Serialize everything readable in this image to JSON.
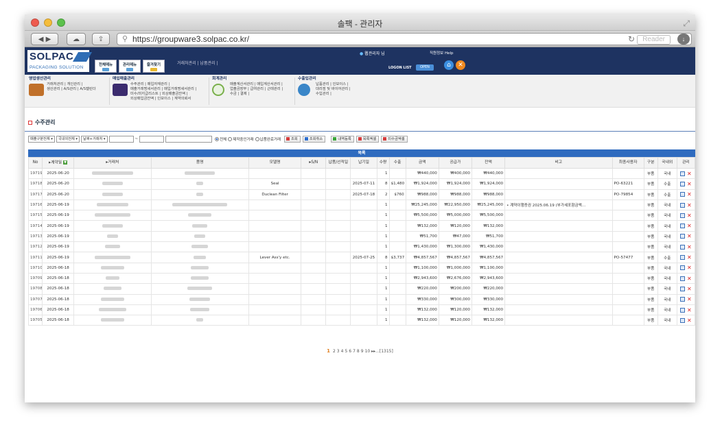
{
  "window": {
    "title": "솔팩 - 관리자"
  },
  "browser": {
    "url": "https://groupware3.solpac.co.kr/",
    "reader_label": "Reader"
  },
  "header": {
    "logo_main": "SOLPAC",
    "logo_sub": "PACKAGING SOLUTION",
    "tabs": [
      "전체메뉴",
      "관리메뉴",
      "즐겨찾기"
    ],
    "links": "거래처관리 | 납품관리 |",
    "user": "웹관리자 님",
    "top_links": "직원정보  Help",
    "logon_list": "LOGON LIST",
    "open_label": "OPEN"
  },
  "categories": [
    {
      "title": "영업생산관리",
      "lines": [
        "거래처관리 | 개인관리 |",
        "생산관리 | A/S관리 | A/S캘린더"
      ]
    },
    {
      "title": "매입매출관리",
      "lines": [
        "수주관리 | 매입자재관리 |",
        "매출거래명세서관리 | 매입거래명세서관리 |",
        "미수/미지급리스트 | 외상매출금잔액 |",
        "외상매입금잔액 | 인보이스 | 계약의뢰서"
      ]
    },
    {
      "title": "회계관리",
      "lines": [
        "매출계산서관리 | 매입계산서관리 |",
        "업출금장부 | 급여관리 | 근태관리 |",
        "수금 | 결제 |"
      ]
    },
    {
      "title": "수출입관리",
      "lines": [
        "납품관리 | 인보이스 |",
        "대리점 및 바이어관리 |",
        "수입관리 |"
      ]
    }
  ],
  "page": {
    "title": "수주관리",
    "list_label": "목록"
  },
  "filters": {
    "select1": "매출구분전체",
    "select2": "국내외전체",
    "select3": "날짜+거래처",
    "tilde": "~",
    "radios": [
      "전체",
      "제작중인거래",
      "납품완료거래"
    ],
    "buttons": [
      "조회",
      "조회취소",
      "내역등록",
      "목록엑셀",
      "미수금엑셀"
    ]
  },
  "columns": [
    "No",
    "▸계약일",
    "▸거래처",
    "품명",
    "모델명",
    "▸S/N",
    "납품/선적일",
    "납기일",
    "수량",
    "수출",
    "금액",
    "공급가",
    "잔액",
    "비고",
    "최종사용자",
    "구분",
    "국내외",
    "관리"
  ],
  "rows": [
    {
      "no": "19719",
      "date": "2025-06-20",
      "model": "",
      "due": "",
      "qty": "1",
      "export": "",
      "amount": "₩440,000",
      "supply": "₩400,000",
      "balance": "₩440,000",
      "note": "",
      "enduser": "",
      "type": "부품",
      "region": "국내"
    },
    {
      "no": "19718",
      "date": "2025-06-20",
      "model": "Seal",
      "due": "2025-07-11",
      "qty": "8",
      "export": "$1,480",
      "amount": "₩1,924,000",
      "supply": "₩1,924,000",
      "balance": "₩1,924,000",
      "note": "",
      "enduser": "PO-63221",
      "type": "부품",
      "region": "수출"
    },
    {
      "no": "19717",
      "date": "2025-06-20",
      "model": "Duclean Filter",
      "due": "2025-07-18",
      "qty": "2",
      "export": "$760",
      "amount": "₩988,000",
      "supply": "₩988,000",
      "balance": "₩988,000",
      "note": "",
      "enduser": "PO-79854",
      "type": "부품",
      "region": "수출"
    },
    {
      "no": "19716",
      "date": "2025-06-19",
      "model": "",
      "due": "",
      "qty": "1",
      "export": "",
      "amount": "₩25,245,000",
      "supply": "₩22,950,000",
      "balance": "₩25,245,000",
      "note": "• 계약이행증권 2025.06.19 (부가세포함금액...",
      "enduser": "",
      "type": "부품",
      "region": "국내"
    },
    {
      "no": "19715",
      "date": "2025-06-19",
      "model": "",
      "due": "",
      "qty": "1",
      "export": "",
      "amount": "₩5,500,000",
      "supply": "₩5,000,000",
      "balance": "₩5,500,000",
      "note": "",
      "enduser": "",
      "type": "부품",
      "region": "국내"
    },
    {
      "no": "19714",
      "date": "2025-06-19",
      "model": "",
      "due": "",
      "qty": "1",
      "export": "",
      "amount": "₩132,000",
      "supply": "₩120,000",
      "balance": "₩132,000",
      "note": "",
      "enduser": "",
      "type": "부품",
      "region": "국내"
    },
    {
      "no": "19713",
      "date": "2025-06-19",
      "model": "",
      "due": "",
      "qty": "1",
      "export": "",
      "amount": "₩51,700",
      "supply": "₩47,000",
      "balance": "₩51,700",
      "note": "",
      "enduser": "",
      "type": "부품",
      "region": "국내"
    },
    {
      "no": "19712",
      "date": "2025-06-19",
      "model": "",
      "due": "",
      "qty": "1",
      "export": "",
      "amount": "₩1,430,000",
      "supply": "₩1,300,000",
      "balance": "₩1,430,000",
      "note": "",
      "enduser": "",
      "type": "부품",
      "region": "국내"
    },
    {
      "no": "19711",
      "date": "2025-06-19",
      "model": "Lever Ass'y etc.",
      "due": "2025-07-25",
      "qty": "8",
      "export": "$3,737",
      "amount": "₩4,857,567",
      "supply": "₩4,857,567",
      "balance": "₩4,857,567",
      "note": "",
      "enduser": "PO-57477",
      "type": "부품",
      "region": "수출"
    },
    {
      "no": "19710",
      "date": "2025-06-18",
      "model": "",
      "due": "",
      "qty": "1",
      "export": "",
      "amount": "₩1,100,000",
      "supply": "₩1,000,000",
      "balance": "₩1,100,000",
      "note": "",
      "enduser": "",
      "type": "부품",
      "region": "국내"
    },
    {
      "no": "19709",
      "date": "2025-06-18",
      "model": "",
      "due": "",
      "qty": "1",
      "export": "",
      "amount": "₩2,943,600",
      "supply": "₩2,676,000",
      "balance": "₩2,943,600",
      "note": "",
      "enduser": "",
      "type": "부품",
      "region": "국내"
    },
    {
      "no": "19708",
      "date": "2025-06-18",
      "model": "",
      "due": "",
      "qty": "1",
      "export": "",
      "amount": "₩220,000",
      "supply": "₩200,000",
      "balance": "₩220,000",
      "note": "",
      "enduser": "",
      "type": "부품",
      "region": "국내"
    },
    {
      "no": "19707",
      "date": "2025-06-18",
      "model": "",
      "due": "",
      "qty": "1",
      "export": "",
      "amount": "₩330,000",
      "supply": "₩300,000",
      "balance": "₩330,000",
      "note": "",
      "enduser": "",
      "type": "부품",
      "region": "국내"
    },
    {
      "no": "19706",
      "date": "2025-06-18",
      "model": "",
      "due": "",
      "qty": "1",
      "export": "",
      "amount": "₩132,000",
      "supply": "₩120,000",
      "balance": "₩132,000",
      "note": "",
      "enduser": "",
      "type": "부품",
      "region": "국내"
    },
    {
      "no": "19705",
      "date": "2025-06-18",
      "model": "",
      "due": "",
      "qty": "1",
      "export": "",
      "amount": "₩132,000",
      "supply": "₩120,000",
      "balance": "₩132,000",
      "note": "",
      "enduser": "",
      "type": "부품",
      "region": "국내"
    }
  ],
  "pager": {
    "current": "1",
    "pages": [
      "2",
      "3",
      "4",
      "5",
      "6",
      "7",
      "8",
      "9",
      "10"
    ],
    "more": "▸▸...[1315]"
  },
  "colors": {
    "header_bg": "#1e3361",
    "accent_blue": "#2f6bbf",
    "page_current": "#e08020"
  }
}
